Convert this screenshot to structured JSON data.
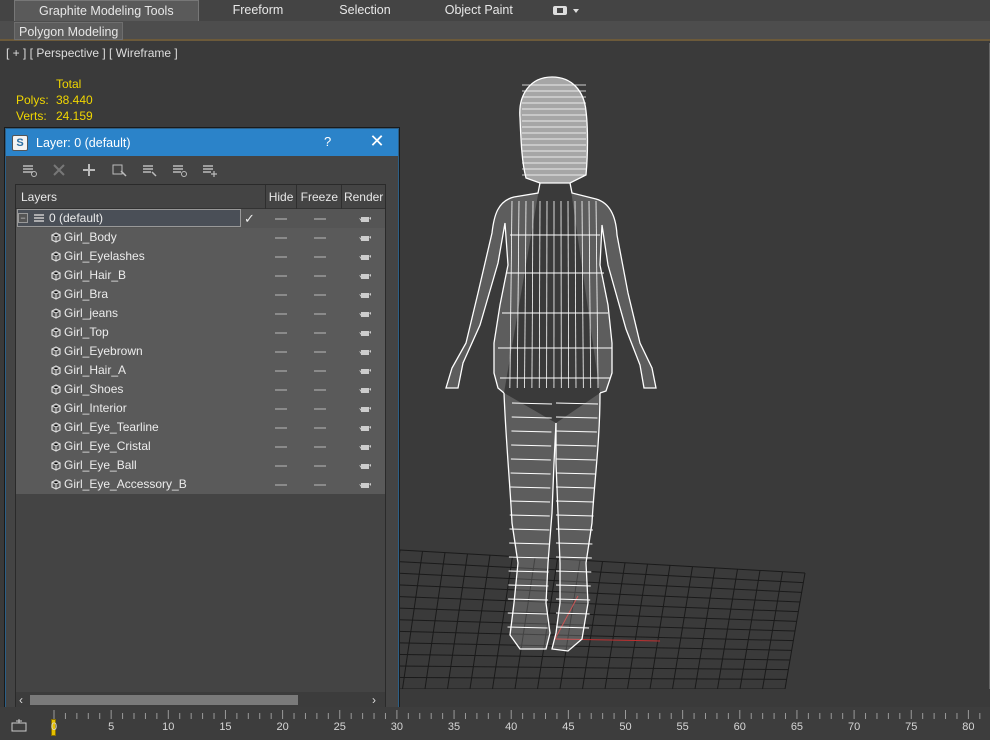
{
  "ribbon": {
    "tabs": [
      "Graphite Modeling Tools",
      "Freeform",
      "Selection",
      "Object Paint"
    ],
    "panel_label": "Polygon Modeling"
  },
  "viewport": {
    "label": "[ + ] [ Perspective ] [ Wireframe ]",
    "stats": {
      "header": "Total",
      "polys_label": "Polys:",
      "polys_value": "38.440",
      "verts_label": "Verts:",
      "verts_value": "24.159"
    }
  },
  "layer_dialog": {
    "title": "Layer: 0 (default)",
    "help": "?",
    "close": "✕",
    "columns": {
      "layers": "Layers",
      "hide": "Hide",
      "freeze": "Freeze",
      "render": "Render"
    },
    "root_layer": "0 (default)",
    "objects": [
      "Girl_Body",
      "Girl_Eyelashes",
      "Girl_Hair_B",
      "Girl_Bra",
      "Girl_jeans",
      "Girl_Top",
      "Girl_Eyebrown",
      "Girl_Hair_A",
      "Girl_Shoes",
      "Girl_Interior",
      "Girl_Eye_Tearline",
      "Girl_Eye_Cristal",
      "Girl_Eye_Ball",
      "Girl_Eye_Accessory_B"
    ]
  },
  "timeline": {
    "ticks": [
      "0",
      "5",
      "10",
      "15",
      "20",
      "25",
      "30",
      "35",
      "40",
      "45",
      "50",
      "55",
      "60",
      "65",
      "70",
      "75",
      "80"
    ],
    "current_frame": 0
  },
  "colors": {
    "stats_text": "#f0d600",
    "dialog_titlebar": "#2b83c9",
    "wireframe": "#ffffff",
    "grid": "#1a1a1a"
  }
}
